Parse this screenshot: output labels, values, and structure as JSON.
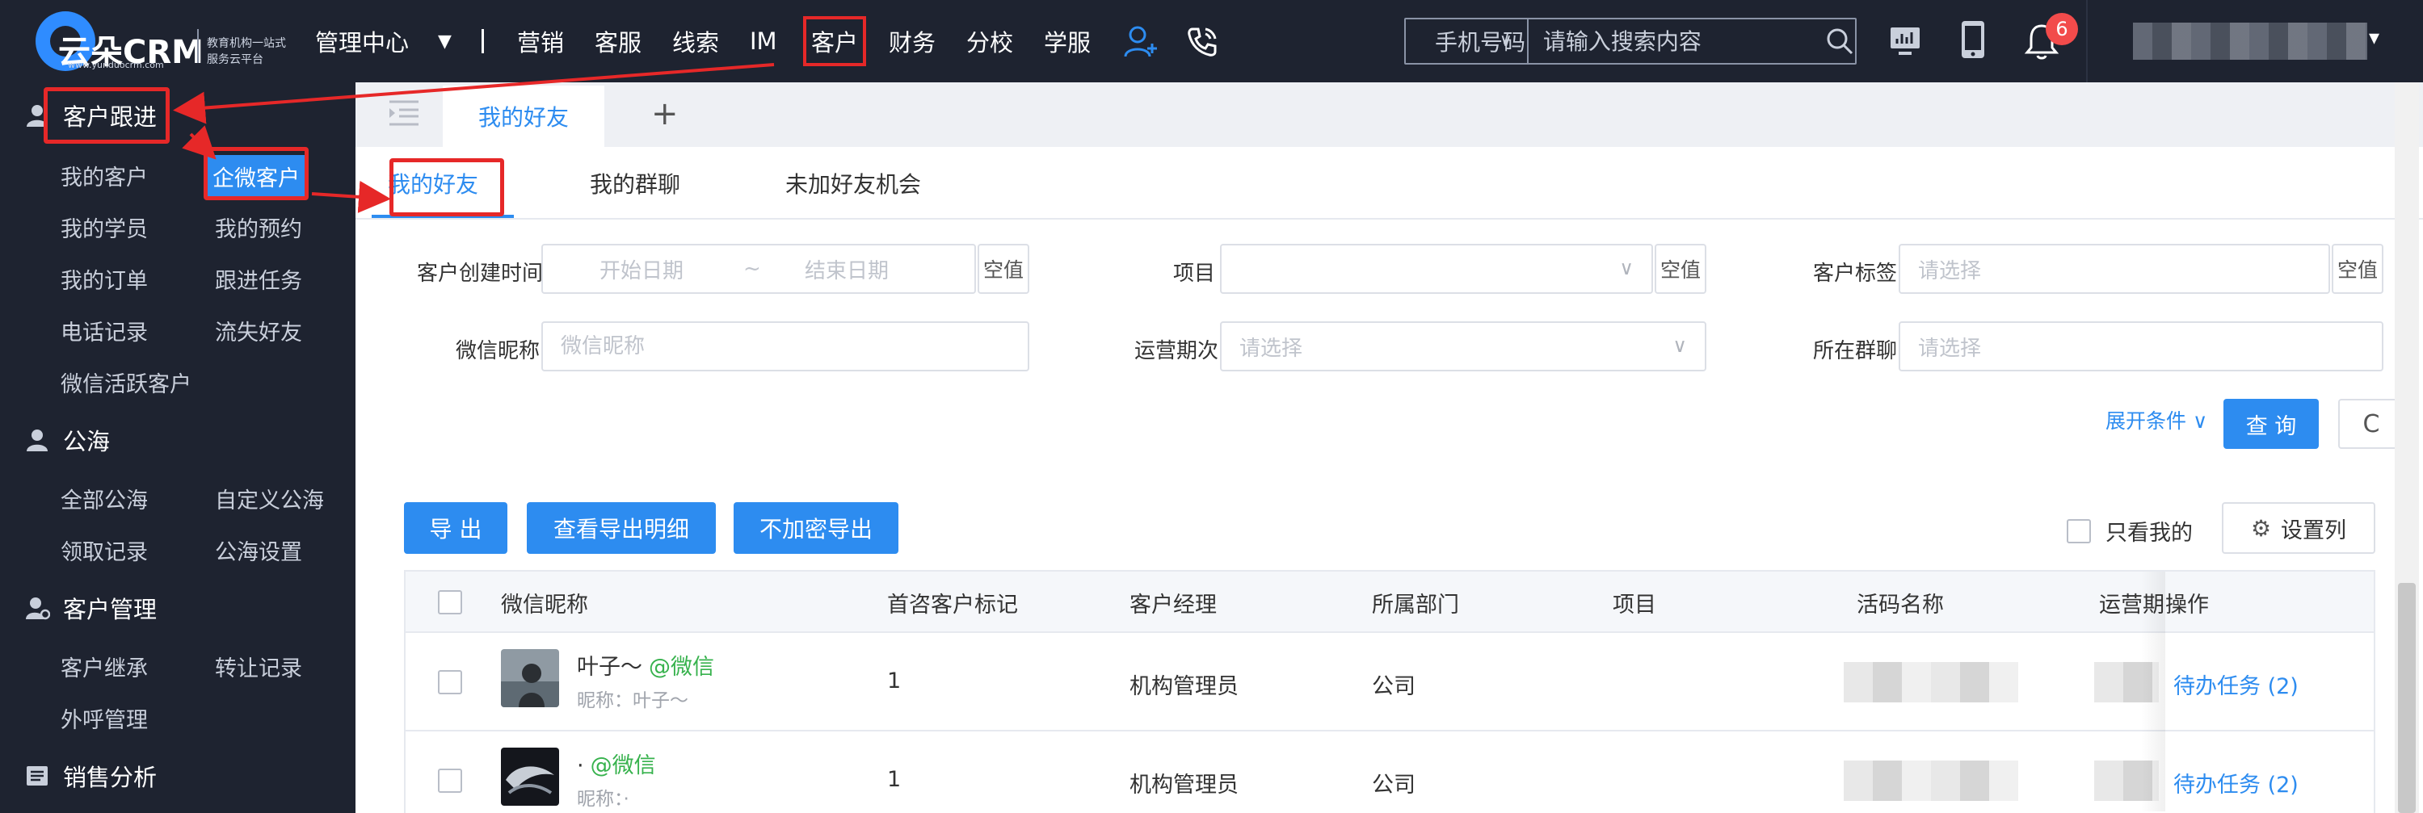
{
  "header": {
    "logo": {
      "name": "云朵CRM",
      "sub": "www.yunduocrm.com",
      "slogan": "教育机构一站式服务云平台"
    },
    "mgmt_center": "管理中心",
    "caret": "▼",
    "nav": [
      "营销",
      "客服",
      "线索",
      "IM",
      "客户",
      "财务",
      "分校",
      "学服"
    ],
    "active_nav": "客户",
    "search": {
      "type": "手机号码",
      "placeholder": "请输入搜索内容"
    },
    "notification_count": "6",
    "user_caret": "▾"
  },
  "sidebar": {
    "sections": [
      {
        "title": "客户跟进",
        "items": [
          "我的客户",
          "企微客户",
          "我的学员",
          "我的预约",
          "我的订单",
          "跟进任务",
          "电话记录",
          "流失好友",
          "微信活跃客户"
        ]
      },
      {
        "title": "公海",
        "items": [
          "全部公海",
          "自定义公海",
          "领取记录",
          "公海设置"
        ]
      },
      {
        "title": "客户管理",
        "items": [
          "客户继承",
          "转让记录",
          "外呼管理"
        ]
      },
      {
        "title": "销售分析",
        "items": []
      }
    ],
    "active_item": "企微客户"
  },
  "tabs": {
    "page_tab": "我的好友",
    "add": "+"
  },
  "subtabs": [
    "我的好友",
    "我的群聊",
    "未加好友机会"
  ],
  "filters": {
    "create_time_label": "客户创建时间",
    "start_placeholder": "开始日期",
    "range_sep": "~",
    "end_placeholder": "结束日期",
    "clear": "空值",
    "project_label": "项目",
    "tag_label": "客户标签",
    "tag_placeholder": "请选择",
    "nickname_label": "微信昵称",
    "nickname_placeholder": "微信昵称",
    "period_label": "运营期次",
    "period_placeholder": "请选择",
    "group_label": "所在群聊",
    "group_placeholder": "请选择",
    "expand": "展开条件",
    "query": "查 询",
    "refresh": "C"
  },
  "toolbar": {
    "export": "导 出",
    "export_detail": "查看导出明细",
    "export_plain": "不加密导出",
    "only_mine": "只看我的",
    "set_columns": "设置列"
  },
  "table": {
    "headers": [
      "微信昵称",
      "首咨客户标记",
      "客户经理",
      "所属部门",
      "项目",
      "活码名称",
      "运营期",
      "操作"
    ],
    "rows": [
      {
        "nickname": "叶子～",
        "wx_tag": "@微信",
        "subnick": "昵称：叶子～",
        "first_mark": "1",
        "manager": "机构管理员",
        "dept": "公司",
        "op": "待办任务 (2)"
      },
      {
        "nickname": "·",
        "wx_tag": "@微信",
        "subnick": "昵称：·",
        "first_mark": "1",
        "manager": "机构管理员",
        "dept": "公司",
        "op": "待办任务 (2)"
      }
    ]
  },
  "colors": {
    "topbar": "#1e2330",
    "accent": "#2d8cf0",
    "annotation": "#e62828",
    "badge": "#f24b4b",
    "wechat": "#37b24d"
  }
}
